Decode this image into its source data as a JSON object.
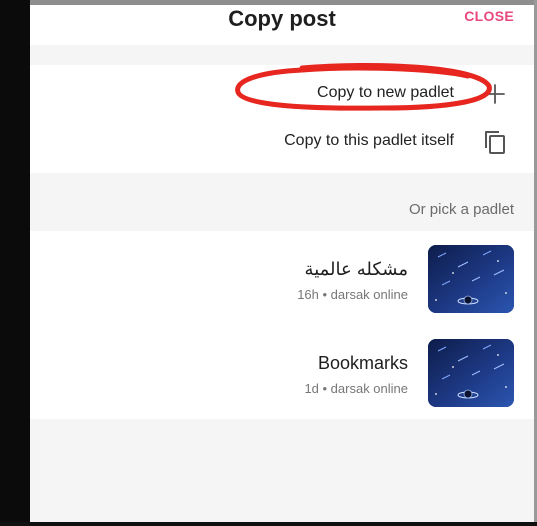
{
  "dialog": {
    "title": "Copy post",
    "close_label": "CLOSE"
  },
  "actions": [
    {
      "label": "Copy to new padlet",
      "icon": "plus-icon"
    },
    {
      "label": "Copy to this padlet itself",
      "icon": "copy-icon"
    }
  ],
  "section": {
    "label": "Or pick a padlet"
  },
  "padlets": [
    {
      "name": "مشكله عالمية",
      "meta": "16h • darsak online",
      "thumbnail": "space-thumbnail"
    },
    {
      "name": "Bookmarks",
      "meta": "1d • darsak online",
      "thumbnail": "space-thumbnail"
    }
  ],
  "colors": {
    "accent": "#e8487f",
    "annotation": "#e6261f",
    "thumbnail_bg": "#1a3270",
    "section_bg": "#f5f5f5"
  }
}
